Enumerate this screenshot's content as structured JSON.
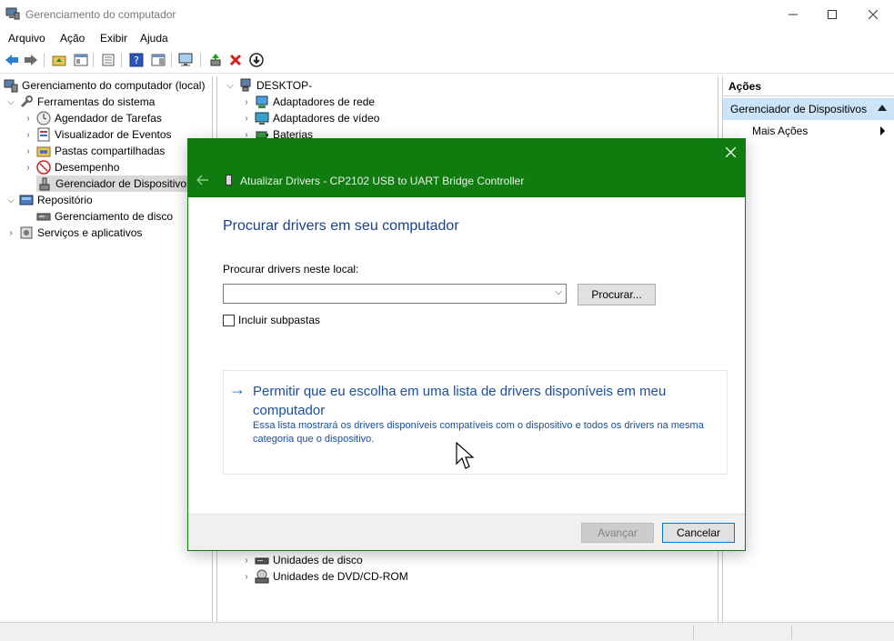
{
  "window": {
    "title": "Gerenciamento do computador"
  },
  "menu": [
    "Arquivo",
    "Ação",
    "Exibir",
    "Ajuda"
  ],
  "left_tree": [
    {
      "label": "Gerenciamento do computador (local)",
      "level": 0,
      "expander": "none",
      "icon": "computer-management-icon"
    },
    {
      "label": "Ferramentas do sistema",
      "level": 1,
      "expander": "expanded",
      "icon": "tools-icon"
    },
    {
      "label": "Agendador de Tarefas",
      "level": 2,
      "expander": "collapsed",
      "icon": "clock-icon"
    },
    {
      "label": "Visualizador de Eventos",
      "level": 2,
      "expander": "collapsed",
      "icon": "event-viewer-icon"
    },
    {
      "label": "Pastas compartilhadas",
      "level": 2,
      "expander": "collapsed",
      "icon": "shared-folder-icon"
    },
    {
      "label": "Desempenho",
      "level": 2,
      "expander": "collapsed",
      "icon": "performance-icon"
    },
    {
      "label": "Gerenciador de Dispositivos",
      "level": 2,
      "expander": "none",
      "icon": "device-manager-icon",
      "selected": true
    },
    {
      "label": "Repositório",
      "level": 1,
      "expander": "expanded",
      "icon": "storage-icon"
    },
    {
      "label": "Gerenciamento de disco",
      "level": 2,
      "expander": "none",
      "icon": "disk-icon"
    },
    {
      "label": "Serviços e aplicativos",
      "level": 1,
      "expander": "collapsed",
      "icon": "services-icon"
    }
  ],
  "device_tree": {
    "root": "DESKTOP-",
    "top_items": [
      "Adaptadores de rede",
      "Adaptadores de vídeo",
      "Baterias"
    ],
    "bottom_items": [
      "Unidades de disco",
      "Unidades de DVD/CD-ROM"
    ]
  },
  "actions": {
    "header": "Ações",
    "section": "Gerenciador de Dispositivos",
    "item": "Mais Ações"
  },
  "dialog": {
    "title": "Atualizar Drivers - CP2102 USB to UART Bridge Controller",
    "heading": "Procurar drivers em seu computador",
    "path_label": "Procurar drivers neste local:",
    "path_value": "",
    "browse_button": "Procurar...",
    "include_subfolders": "Incluir subpastas",
    "include_subfolders_checked": false,
    "option_main": "Permitir que eu escolha em uma lista de drivers disponíveis em meu computador",
    "option_sub": "Essa lista mostrará os drivers disponíveis compatíveis com o dispositivo e todos os drivers na mesma categoria que o dispositivo.",
    "next_button": "Avançar",
    "cancel_button": "Cancelar"
  },
  "colors": {
    "dialog_header": "#107c10",
    "link_blue": "#1a4fa0",
    "heading_blue": "#1a3f8c",
    "selection": "#cce4f7"
  }
}
